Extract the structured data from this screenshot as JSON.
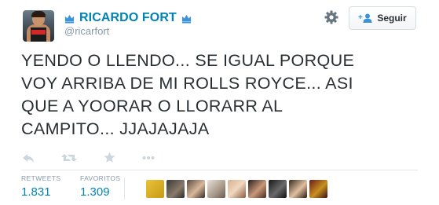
{
  "user": {
    "display_name": "RICARDO FORT",
    "screen_name": "@ricarfort"
  },
  "follow_button": {
    "label": "Seguir"
  },
  "tweet": {
    "lines": [
      "YENDO O LLENDO... SE IGUAL PORQUE",
      "VOY ARRIBA DE MI ROLLS ROYCE...  ASI",
      "QUE A YOORAR O LLORARR AL",
      "CAMPITO... JJAJAJAJA"
    ]
  },
  "actions": {
    "icons": [
      "reply-icon",
      "retweet-icon",
      "favorite-icon",
      "more-icon"
    ]
  },
  "stats": {
    "retweets_label": "RETWEETS",
    "retweets_value": "1.831",
    "favorites_label": "FAVORITOS",
    "favorites_value": "1.309"
  },
  "favoriters": {
    "count": 9
  },
  "colors": {
    "link_blue": "#0084b4",
    "crown_blue": "#3b94d9",
    "text": "#292f33",
    "muted": "#8899a6",
    "divider": "#e1e8ed"
  }
}
